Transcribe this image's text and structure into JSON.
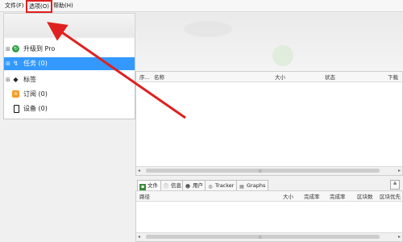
{
  "menubar": {
    "file": "文件(F)",
    "options": "选项(O)",
    "help": "帮助(H)"
  },
  "sidebar": {
    "items": [
      {
        "label": "升级到 Pro",
        "icon": "upgrade-icon"
      },
      {
        "label": "任务 (0)",
        "icon": "tasks-icon",
        "selected": true
      },
      {
        "label": "标签",
        "icon": "tag-icon"
      },
      {
        "label": "订阅 (0)",
        "icon": "rss-icon"
      },
      {
        "label": "设备 (0)",
        "icon": "device-icon"
      }
    ]
  },
  "torrent_list": {
    "columns": [
      "序...",
      "名称",
      "大小",
      "状态",
      "下载"
    ]
  },
  "details": {
    "tabs": [
      {
        "label": "文件",
        "icon": "files-icon",
        "active": true
      },
      {
        "label": "信息",
        "icon": "info-icon"
      },
      {
        "label": "用户",
        "icon": "peers-icon"
      },
      {
        "label": "Tracker",
        "icon": "tracker-icon"
      },
      {
        "label": "Graphs",
        "icon": "graphs-icon"
      }
    ],
    "columns": [
      "路径",
      "大小",
      "完成率",
      "完成率",
      "区块数",
      "区块优先"
    ]
  },
  "colors": {
    "selection": "#3399ff",
    "highlight_box": "#e02020",
    "arrow": "#e02020"
  }
}
